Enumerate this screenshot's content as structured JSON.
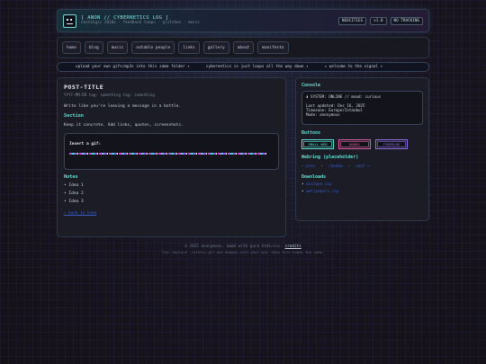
{
  "header": {
    "title": "[ ANON // CYBERNETICS LOG ]",
    "subtitle": "nostalgic 2010s · feedback loops · glitches · music",
    "badges": [
      "NEOCITIES",
      "v1.0",
      "NO TRACKING"
    ]
  },
  "nav": {
    "items": [
      "home",
      "blog",
      "music",
      "notable people",
      "links",
      "gallery",
      "about",
      "manifesto"
    ]
  },
  "ticker": {
    "items": [
      "upload your own gifs/mp3s into this same folder ✦",
      "cybernetics is just loops all the way down ✦",
      "✦ welcome to the signal ✦"
    ]
  },
  "post": {
    "title": "POST-TITLE",
    "meta": "YYYY-MM-DD  tag: something  tag: something",
    "intro": "Write like you're leaving a message in a bottle.",
    "section_heading": "Section",
    "section_text": "Keep it concrete. Add links, quotes, screenshots.",
    "gif_label": "Insert a gif:",
    "notes_heading": "Notes",
    "notes": [
      "Idea 1",
      "Idea 2",
      "Idea 3"
    ],
    "back_link": "← back to home"
  },
  "sidebar": {
    "console_heading": "Console",
    "console": {
      "status": "▮ SYSTEM: ONLINE // mood: curious",
      "last_updated": "Last updated: Dec 16, 2025",
      "timezone": "Timezone: Europe/Istanbul",
      "mode": "Mode: anonymous"
    },
    "buttons_heading": "Buttons",
    "buttons": [
      "SMALL WEB",
      "NOADS",
      "CYBERLOG"
    ],
    "webring_heading": "Webring (placeholder)",
    "webring": {
      "prev": "← prev",
      "sep1": "·",
      "random": "random",
      "sep2": "·",
      "next": "next →"
    },
    "downloads_heading": "Downloads",
    "downloads": [
      "mixtape.zip",
      "wallpapers.zip"
    ]
  },
  "footer": {
    "line1_prefix": "© 2025 anonymous. made with pure html/css.",
    "line1_link": "credits",
    "line2": "Tip: Replace ./static.gif and badges with your own. Keep file names the same."
  },
  "colors": {
    "accent": "#5fe0d2",
    "title": "#7fe3e3",
    "link": "#3a5cc8",
    "pink": "#d65fa8",
    "purple": "#8d6fe0"
  }
}
